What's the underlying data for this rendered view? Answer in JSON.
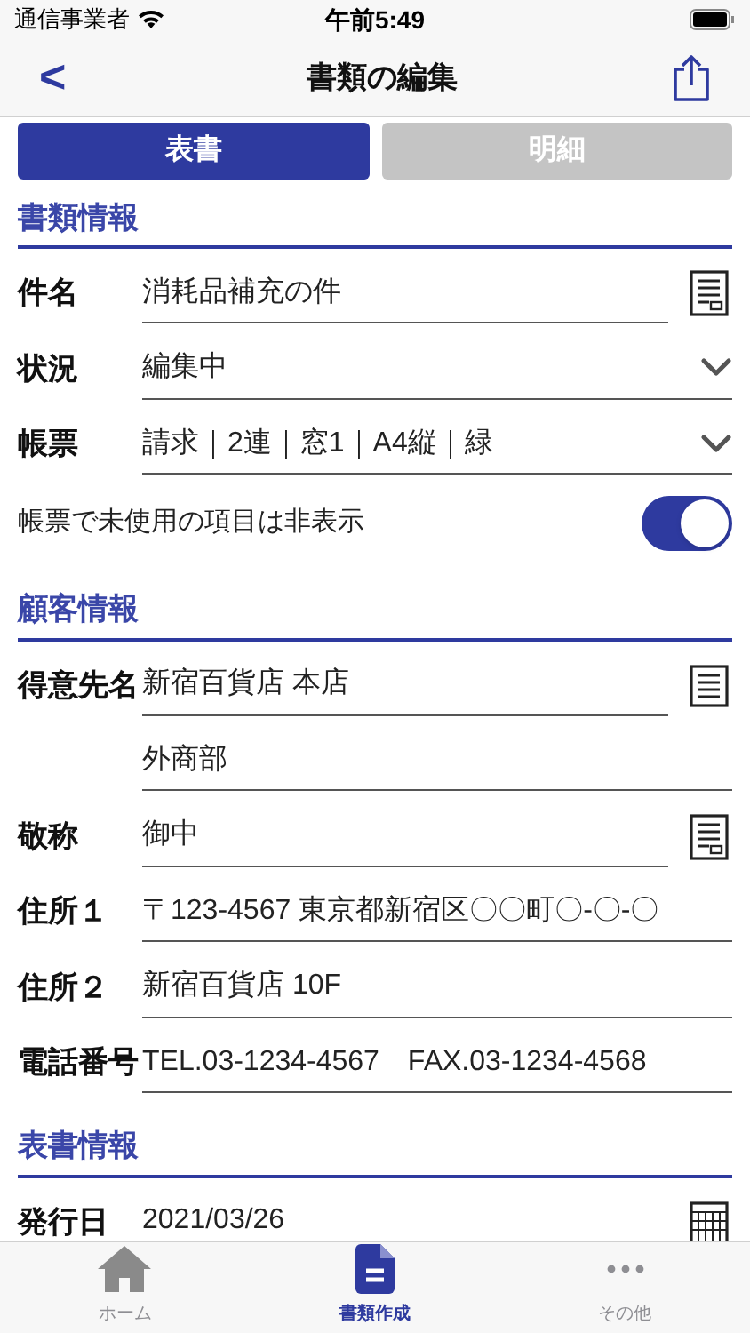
{
  "status_bar": {
    "carrier": "通信事業者",
    "time": "午前5:49"
  },
  "nav": {
    "back": "<",
    "title": "書類の編集"
  },
  "segments": [
    {
      "label": "表書",
      "selected": true
    },
    {
      "label": "明細",
      "selected": false
    }
  ],
  "sections": [
    {
      "title": "書類情報",
      "rows": [
        {
          "kind": "memo",
          "label": "件名",
          "value": "消耗品補充の件"
        },
        {
          "kind": "select",
          "label": "状況",
          "value": "編集中"
        },
        {
          "kind": "select",
          "label": "帳票",
          "value": "請求｜2連｜窓1｜A4縦｜緑"
        },
        {
          "kind": "toggle",
          "label": "帳票で未使用の項目は非表示",
          "on": true
        }
      ]
    },
    {
      "title": "顧客情報",
      "rows": [
        {
          "kind": "list",
          "label": "得意先名",
          "value": "新宿百貨店 本店"
        },
        {
          "kind": "text",
          "value": "外商部"
        },
        {
          "kind": "memo",
          "label": "敬称",
          "value": "御中"
        },
        {
          "kind": "text",
          "label": "住所１",
          "value": "〒123-4567 東京都新宿区〇〇町〇-〇-〇"
        },
        {
          "kind": "text",
          "label": "住所２",
          "value": "新宿百貨店 10F"
        },
        {
          "kind": "text",
          "label": "電話番号",
          "value": "TEL.03-1234-4567　FAX.03-1234-4568"
        }
      ]
    },
    {
      "title": "表書情報",
      "rows": [
        {
          "kind": "date",
          "label": "発行日",
          "value": "2021/03/26"
        }
      ]
    }
  ],
  "tab_bar": [
    {
      "label": "ホーム",
      "selected": false
    },
    {
      "label": "書類作成",
      "selected": true
    },
    {
      "label": "その他",
      "selected": false
    }
  ]
}
